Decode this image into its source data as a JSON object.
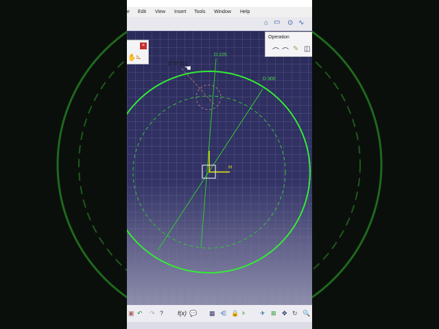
{
  "menu": [
    "e",
    "Edit",
    "View",
    "Insert",
    "Tools",
    "Window",
    "Help"
  ],
  "operation_panel": {
    "title": "Operation"
  },
  "close_label": "×",
  "dimensions": {
    "d225": "D 225",
    "d300": "D 300",
    "d37": "D 37.021",
    "h_axis": "H"
  },
  "bottom_toolbar": {
    "formula": "f(x)"
  },
  "colors": {
    "sketch_green": "#33dd33",
    "background_top": "#2b2b5b",
    "axis_yellow": "#e8e800"
  }
}
